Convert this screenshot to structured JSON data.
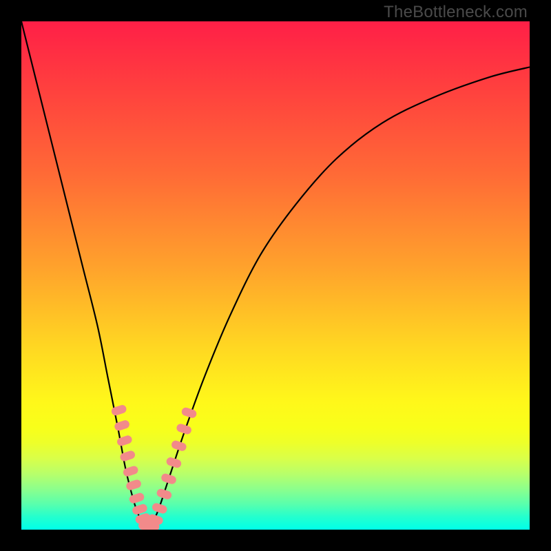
{
  "watermark": "TheBottleneck.com",
  "chart_data": {
    "type": "line",
    "title": "",
    "xlabel": "",
    "ylabel": "",
    "xlim": [
      0,
      100
    ],
    "ylim": [
      0,
      100
    ],
    "series": [
      {
        "name": "bottleneck-curve",
        "x": [
          0,
          3,
          6,
          9,
          12,
          15,
          17,
          19,
          20.5,
          22,
          23,
          24,
          24.8,
          25.6,
          27,
          29,
          32,
          36,
          41,
          47,
          54,
          62,
          71,
          81,
          92,
          100
        ],
        "y": [
          100,
          88,
          76,
          64,
          52,
          40,
          30,
          20,
          12,
          6,
          3,
          1,
          0,
          1,
          4,
          10,
          19,
          30,
          42,
          54,
          64,
          73,
          80,
          85,
          89,
          91
        ]
      }
    ],
    "markers": {
      "name": "highlight-beads",
      "points": [
        {
          "x": 19.2,
          "y": 23.5
        },
        {
          "x": 19.8,
          "y": 20.5
        },
        {
          "x": 20.3,
          "y": 17.5
        },
        {
          "x": 20.9,
          "y": 14.5
        },
        {
          "x": 21.5,
          "y": 11.5
        },
        {
          "x": 22.1,
          "y": 8.8
        },
        {
          "x": 22.7,
          "y": 6.2
        },
        {
          "x": 23.3,
          "y": 4.0
        },
        {
          "x": 23.9,
          "y": 2.2
        },
        {
          "x": 24.5,
          "y": 1.0
        },
        {
          "x": 25.1,
          "y": 0.5
        },
        {
          "x": 25.7,
          "y": 0.8
        },
        {
          "x": 26.4,
          "y": 2.0
        },
        {
          "x": 27.2,
          "y": 4.2
        },
        {
          "x": 28.1,
          "y": 7.0
        },
        {
          "x": 29.0,
          "y": 10.0
        },
        {
          "x": 30.0,
          "y": 13.2
        },
        {
          "x": 31.0,
          "y": 16.5
        },
        {
          "x": 32.0,
          "y": 19.8
        },
        {
          "x": 33.0,
          "y": 23.0
        }
      ]
    },
    "colors": {
      "curve": "#000000",
      "marker_fill": "#f28a8a",
      "marker_stroke": "#e06a6a"
    }
  }
}
